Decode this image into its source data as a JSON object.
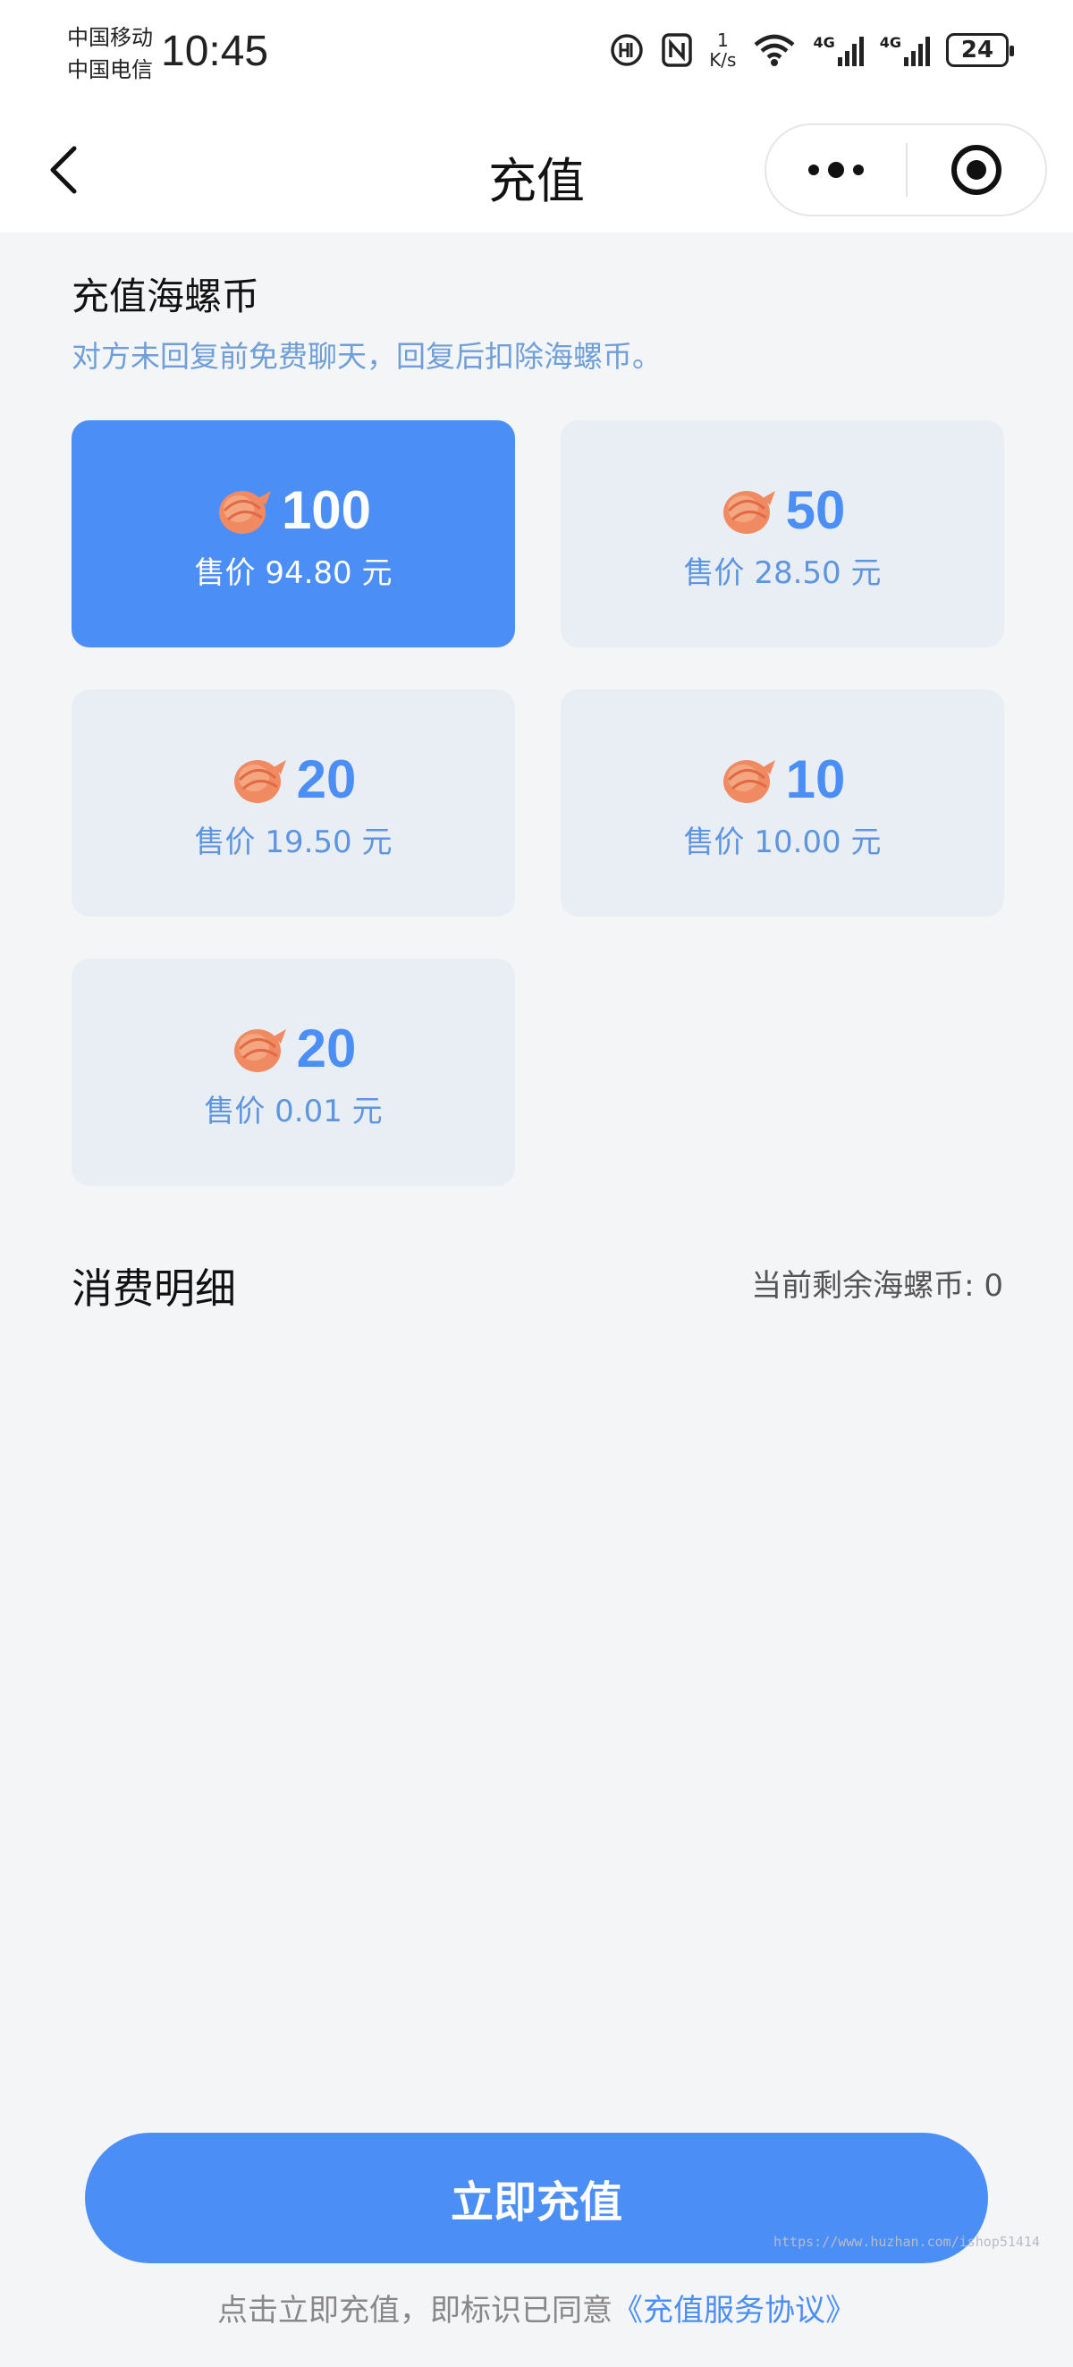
{
  "status_bar": {
    "carrier_1": "中国移动",
    "carrier_2": "中国电信",
    "time": "10:45",
    "net_speed_value": "1",
    "net_speed_unit": "K/s",
    "signal_1_label": "4G",
    "signal_2_label": "4G",
    "battery": "24",
    "icons": [
      "hd-icon",
      "nfc-icon",
      "wifi-icon",
      "signal-icon",
      "battery-icon"
    ]
  },
  "nav": {
    "title": "充值",
    "back_icon": "chevron-left-icon",
    "more_icon": "more-dots-icon",
    "close_icon": "target-icon"
  },
  "section": {
    "title": "充值海螺币",
    "subtitle": "对方未回复前免费聊天，回复后扣除海螺币。"
  },
  "packages": [
    {
      "amount": "100",
      "price": "售价 94.80 元",
      "selected": true
    },
    {
      "amount": "50",
      "price": "售价 28.50 元",
      "selected": false
    },
    {
      "amount": "20",
      "price": "售价 19.50 元",
      "selected": false
    },
    {
      "amount": "10",
      "price": "售价 10.00 元",
      "selected": false
    },
    {
      "amount": "20",
      "price": "售价 0.01 元",
      "selected": false
    }
  ],
  "detail": {
    "title": "消费明细",
    "balance_label": "当前剩余海螺币:",
    "balance_value": "0"
  },
  "footer": {
    "button_label": "立即充值",
    "agreement_prefix": "点击立即充值，即标识已同意",
    "agreement_link": "《充值服务协议》"
  },
  "watermark": "https://www.huzhan.com/ishop51414",
  "colors": {
    "accent": "#4b8ef5",
    "card_bg": "#e9eef5",
    "page_bg": "#f4f5f7",
    "subtitle": "#6e9fd8"
  }
}
